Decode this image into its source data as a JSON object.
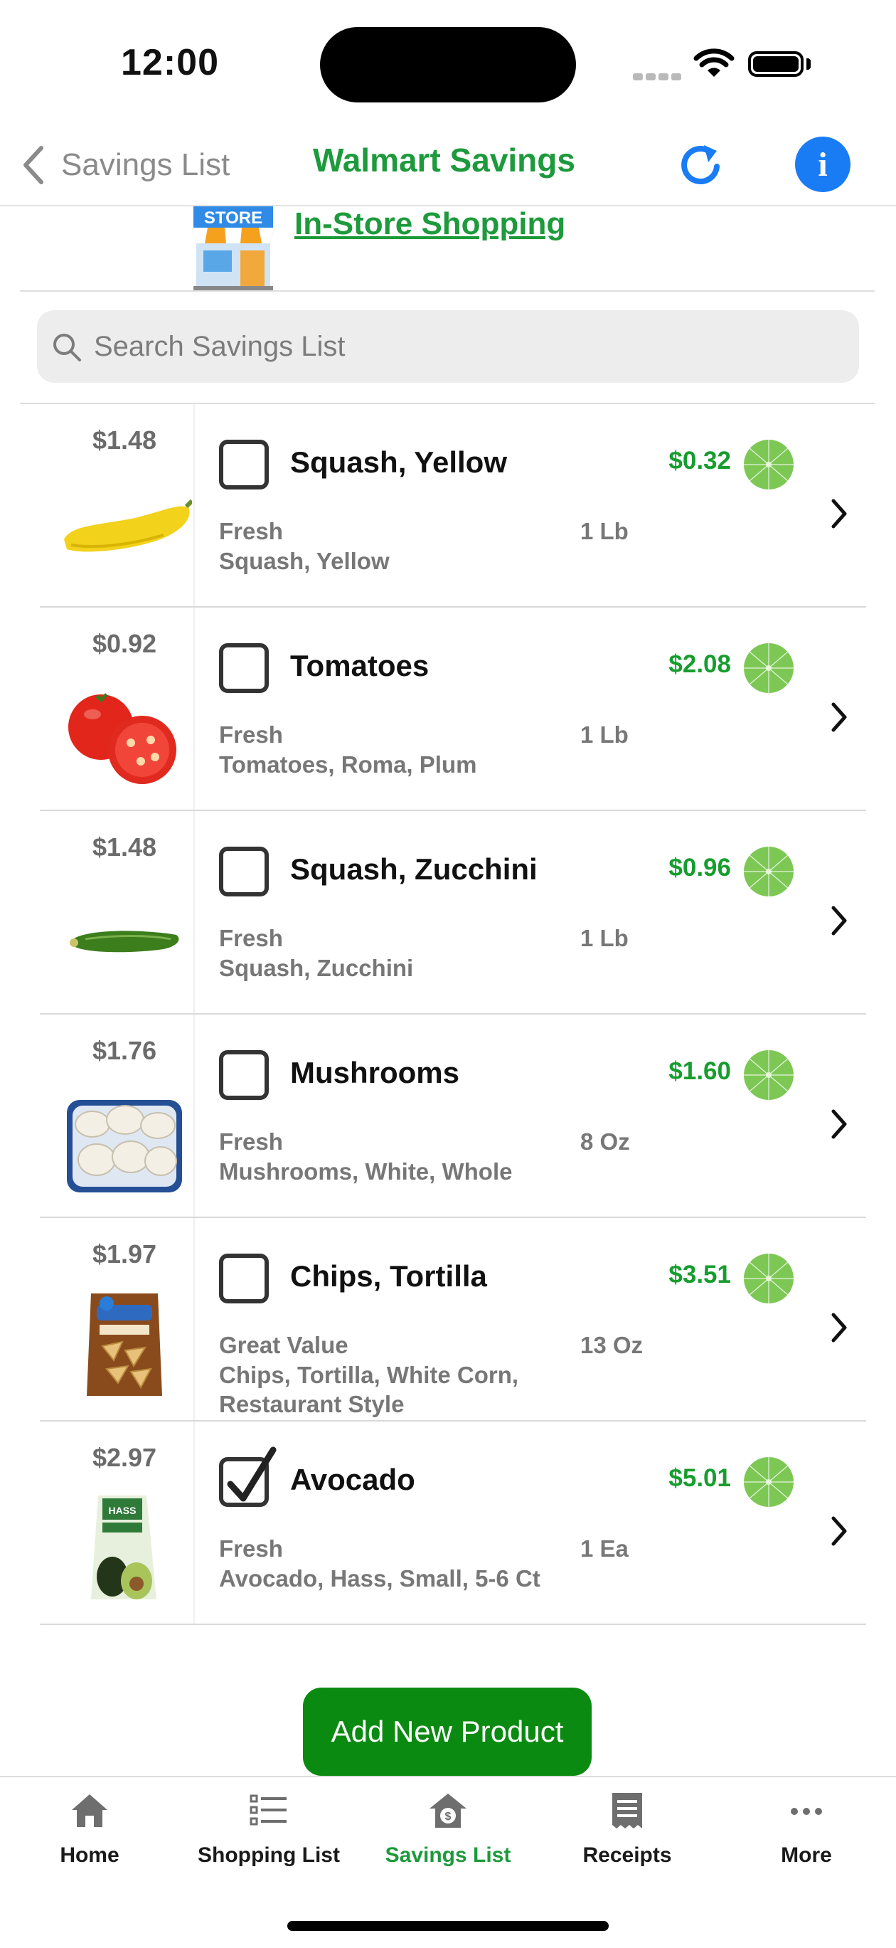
{
  "status": {
    "time": "12:00"
  },
  "nav": {
    "back_label": "Savings List",
    "title": "Walmart Savings",
    "refresh_icon": "refresh-icon",
    "info_icon": "info-icon",
    "info_glyph": "i"
  },
  "store": {
    "icon_text": "STORE",
    "link": "In-Store Shopping"
  },
  "search": {
    "placeholder": "Search Savings List",
    "value": ""
  },
  "colors": {
    "brand_green": "#1d9a3c",
    "savings_green": "#169d2e",
    "button_green": "#0b8a12",
    "info_blue": "#1a7cf5",
    "pie_green": "#7dc855"
  },
  "items": [
    {
      "price": "$1.48",
      "name": "Squash, Yellow",
      "brand": "Fresh",
      "desc": "Squash, Yellow",
      "size": "1 Lb",
      "savings": "$0.32",
      "checked": false,
      "image": "yellow-squash"
    },
    {
      "price": "$0.92",
      "name": "Tomatoes",
      "brand": "Fresh",
      "desc": "Tomatoes, Roma, Plum",
      "size": "1 Lb",
      "savings": "$2.08",
      "checked": false,
      "image": "tomatoes"
    },
    {
      "price": "$1.48",
      "name": "Squash, Zucchini",
      "brand": "Fresh",
      "desc": "Squash, Zucchini",
      "size": "1 Lb",
      "savings": "$0.96",
      "checked": false,
      "image": "zucchini"
    },
    {
      "price": "$1.76",
      "name": "Mushrooms",
      "brand": "Fresh",
      "desc": "Mushrooms, White, Whole",
      "size": "8 Oz",
      "savings": "$1.60",
      "checked": false,
      "image": "mushrooms"
    },
    {
      "price": "$1.97",
      "name": "Chips, Tortilla",
      "brand": "Great Value",
      "desc": "Chips, Tortilla, White Corn, Restaurant Style",
      "size": "13 Oz",
      "savings": "$3.51",
      "checked": false,
      "image": "tortilla-chips"
    },
    {
      "price": "$2.97",
      "name": "Avocado",
      "brand": "Fresh",
      "desc": "Avocado, Hass, Small, 5-6 Ct",
      "size": "1 Ea",
      "savings": "$5.01",
      "checked": true,
      "image": "avocado-bag"
    }
  ],
  "add_button": "Add New Product",
  "tabs": [
    {
      "label": "Home",
      "icon": "home-icon"
    },
    {
      "label": "Shopping List",
      "icon": "list-icon"
    },
    {
      "label": "Savings List",
      "icon": "savings-icon",
      "active": true
    },
    {
      "label": "Receipts",
      "icon": "receipt-icon"
    },
    {
      "label": "More",
      "icon": "more-icon"
    }
  ]
}
